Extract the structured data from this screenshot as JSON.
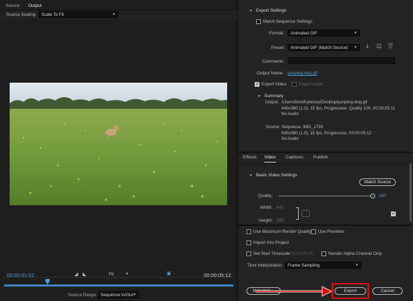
{
  "left_panel": {
    "tabs": [
      "Source",
      "Output"
    ],
    "source_scaling_label": "Source Scaling:",
    "source_scaling_value": "Scale To Fit",
    "current_timecode": "00:00:01:02",
    "end_timecode": "00:00:05:12",
    "zoom_value": "Fit",
    "source_range_label": "Source Range:",
    "source_range_value": "Sequence In/Out",
    "playhead_position": 0.19
  },
  "export_settings": {
    "header": "Export Settings",
    "match_sequence_label": "Match Sequence Settings",
    "format_label": "Format:",
    "format_value": "Animated GIF",
    "preset_label": "Preset:",
    "preset_value": "Animated GIF (Match Source)",
    "comments_label": "Comments:",
    "comments_value": "",
    "output_name_label": "Output Name:",
    "output_name_value": "jumping-dog.gif",
    "export_video_label": "Export Video",
    "export_audio_label": "Export Audio",
    "summary_header": "Summary",
    "output_label": "Output:",
    "output_lines": [
      "/Users/timothybesey/Desktop/jumping-dog.gif",
      "640x360 (1.0), 15 fps, Progressive, Quality 100, 00;00;05;11",
      "No Audio"
    ],
    "source_label": "Source:",
    "source_lines": [
      "Sequence, IMG_1793",
      "640x360 (1.0), 15 fps, Progressive, 00:00:05:12",
      "No Audio"
    ]
  },
  "right_tabs": [
    "Effects",
    "Video",
    "Captions",
    "Publish"
  ],
  "basic_video": {
    "header": "Basic Video Settings",
    "match_source_button": "Match Source",
    "quality_label": "Quality:",
    "quality_value": "100",
    "width_label": "Width:",
    "width_value": "640",
    "height_label": "Height:",
    "height_value": "360"
  },
  "bottom_options": {
    "max_render_quality": "Use Maximum Render Quality",
    "use_previews": "Use Previews",
    "import_into_project": "Import Into Project",
    "set_start_timecode": "Set Start Timecode",
    "start_timecode_value": "00;00;00;00",
    "render_alpha": "Render Alpha Channel Only",
    "time_interpolation_label": "Time Interpolation:",
    "time_interpolation_value": "Frame Sampling"
  },
  "buttons": {
    "metadata": "Metadata...",
    "export": "Export",
    "cancel": "Cancel"
  },
  "colors": {
    "accent_blue": "#4f9ddd",
    "highlight_red": "#e01010"
  }
}
